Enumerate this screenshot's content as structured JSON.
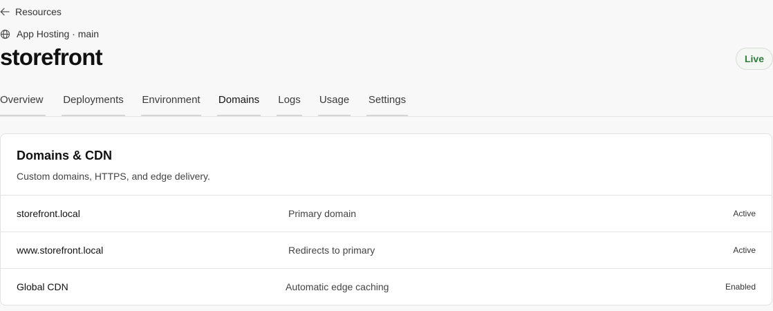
{
  "nav": {
    "back_label": "Resources"
  },
  "service": {
    "line": "App Hosting · main",
    "title": "storefront",
    "status": "Live",
    "status_color": "#2e7d3a"
  },
  "tabs": [
    {
      "label": "Overview"
    },
    {
      "label": "Deployments"
    },
    {
      "label": "Environment"
    },
    {
      "label": "Domains",
      "active": true
    },
    {
      "label": "Logs"
    },
    {
      "label": "Usage"
    },
    {
      "label": "Settings"
    }
  ],
  "domains_card": {
    "title": "Domains & CDN",
    "subtitle": "Custom domains, HTTPS, and edge delivery.",
    "rows": [
      {
        "name": "storefront.local",
        "description": "Primary domain",
        "status": "Active"
      },
      {
        "name": "www.storefront.local",
        "description": "Redirects to primary",
        "status": "Active"
      },
      {
        "name": "Global CDN",
        "description": "Automatic edge caching",
        "status": "Enabled"
      }
    ]
  }
}
